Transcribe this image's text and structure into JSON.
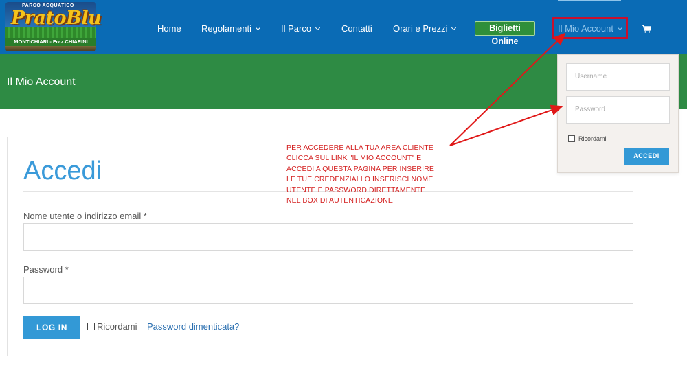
{
  "logo": {
    "tagline": "PARCO ACQUATICO",
    "brand": "PratoBlu",
    "location": "MONTICHIARI - Fraz.CHIARINI"
  },
  "nav": {
    "items": [
      {
        "label": "Home",
        "dropdown": false
      },
      {
        "label": "Regolamenti",
        "dropdown": true
      },
      {
        "label": "Il Parco",
        "dropdown": true
      },
      {
        "label": "Contatti",
        "dropdown": false
      },
      {
        "label": "Orari e Prezzi",
        "dropdown": true
      }
    ],
    "tickets_button": "Biglietti Online",
    "account": "Il Mio Account",
    "cart_icon": "shopping-cart-icon"
  },
  "titlebar": {
    "title": "Il Mio Account"
  },
  "dropdown_login": {
    "username_placeholder": "Username",
    "password_placeholder": "Password",
    "remember_label": "Ricordami",
    "submit_label": "ACCEDI"
  },
  "login_form": {
    "title": "Accedi",
    "username_label": "Nome utente o indirizzo email *",
    "username_value": "",
    "password_label": "Password *",
    "password_value": "",
    "submit_label": "LOG IN",
    "remember_label": "Ricordami",
    "lost_password": "Password dimenticata?"
  },
  "annotation": {
    "lines": [
      "PER ACCEDERE ALLA TUA AREA CLIENTE",
      "CLICCA SUL LINK \"IL MIO ACCOUNT\" E",
      "ACCEDI A QUESTA PAGINA PER INSERIRE",
      "LE TUE CREDENZIALI O INSERISCI NOME",
      "UTENTE E PASSWORD DIRETTAMENTE",
      "NEL BOX DI AUTENTICAZIONE"
    ],
    "color": "#d42020"
  },
  "colors": {
    "header": "#0a6bb5",
    "titlebar": "#2e8b44",
    "accent": "#3399d6",
    "highlight_box": "#c8102e"
  }
}
